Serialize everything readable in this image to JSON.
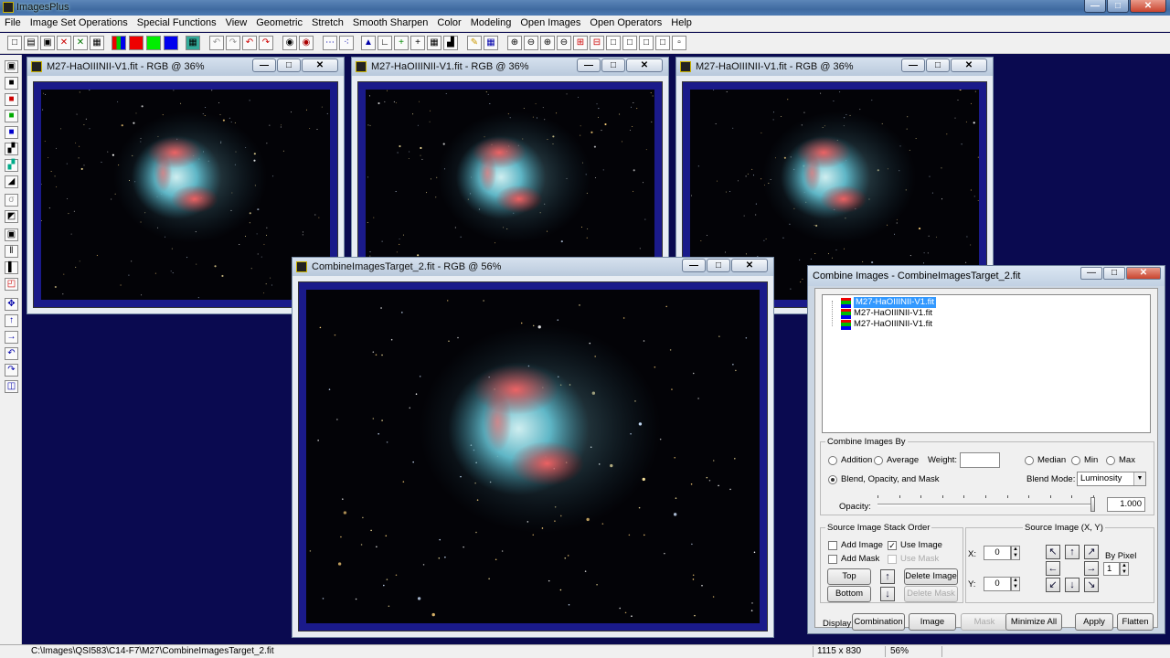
{
  "app": {
    "title": "ImagesPlus"
  },
  "menu": [
    "File",
    "Image Set Operations",
    "Special Functions",
    "View",
    "Geometric",
    "Stretch",
    "Smooth Sharpen",
    "Color",
    "Modeling",
    "Open Images",
    "Open Operators",
    "Help"
  ],
  "windows": [
    {
      "title": "M27-HaOIIINII-V1.fit - RGB @ 36%"
    },
    {
      "title": "M27-HaOIIINII-V1.fit - RGB @ 36%"
    },
    {
      "title": "M27-HaOIIINII-V1.fit - RGB @ 36%"
    },
    {
      "title": "CombineImagesTarget_2.fit - RGB @ 56%"
    }
  ],
  "window_buttons": {
    "minimize": "—",
    "maximize": "□",
    "close": "✕"
  },
  "dialog": {
    "title": "Combine Images - CombineImagesTarget_2.fit",
    "files": [
      "M27-HaOIIINII-V1.fit",
      "M27-HaOIIINII-V1.fit",
      "M27-HaOIIINII-V1.fit"
    ],
    "combine_by": {
      "legend": "Combine Images By",
      "addition": "Addition",
      "average": "Average",
      "weight_label": "Weight:",
      "weight_value": "",
      "median": "Median",
      "min": "Min",
      "max": "Max",
      "blend": "Blend, Opacity, and Mask",
      "blend_mode_label": "Blend Mode:",
      "blend_mode_value": "Luminosity",
      "opacity_label": "Opacity:",
      "opacity_value": "1.000",
      "opacity_fraction": 1.0,
      "selected": "blend"
    },
    "stack_order": {
      "legend": "Source Image Stack Order",
      "add_image": "Add Image",
      "use_image": "Use Image",
      "add_mask": "Add Mask",
      "use_mask": "Use Mask",
      "top": "Top",
      "bottom": "Bottom",
      "delete_image": "Delete Image",
      "delete_mask": "Delete Mask",
      "use_image_checked": true
    },
    "source_xy": {
      "legend": "Source Image (X, Y)",
      "x_label": "X:",
      "x_value": "0",
      "y_label": "Y:",
      "y_value": "0",
      "by_pixel_label": "By Pixel",
      "by_pixel_value": "1"
    },
    "display": {
      "label": "Display:",
      "combination": "Combination",
      "image": "Image",
      "mask": "Mask",
      "minimize_all": "Minimize All",
      "apply": "Apply",
      "flatten": "Flatten"
    }
  },
  "status": {
    "path": "C:\\Images\\QSI583\\C14-F7\\M27\\CombineImagesTarget_2.fit",
    "dimensions": "1115 x 830",
    "zoom": "56%"
  },
  "colors": {
    "workspace": "#0a0a50",
    "image_frame": "#1a1a8a",
    "selection": "#3399ff"
  }
}
